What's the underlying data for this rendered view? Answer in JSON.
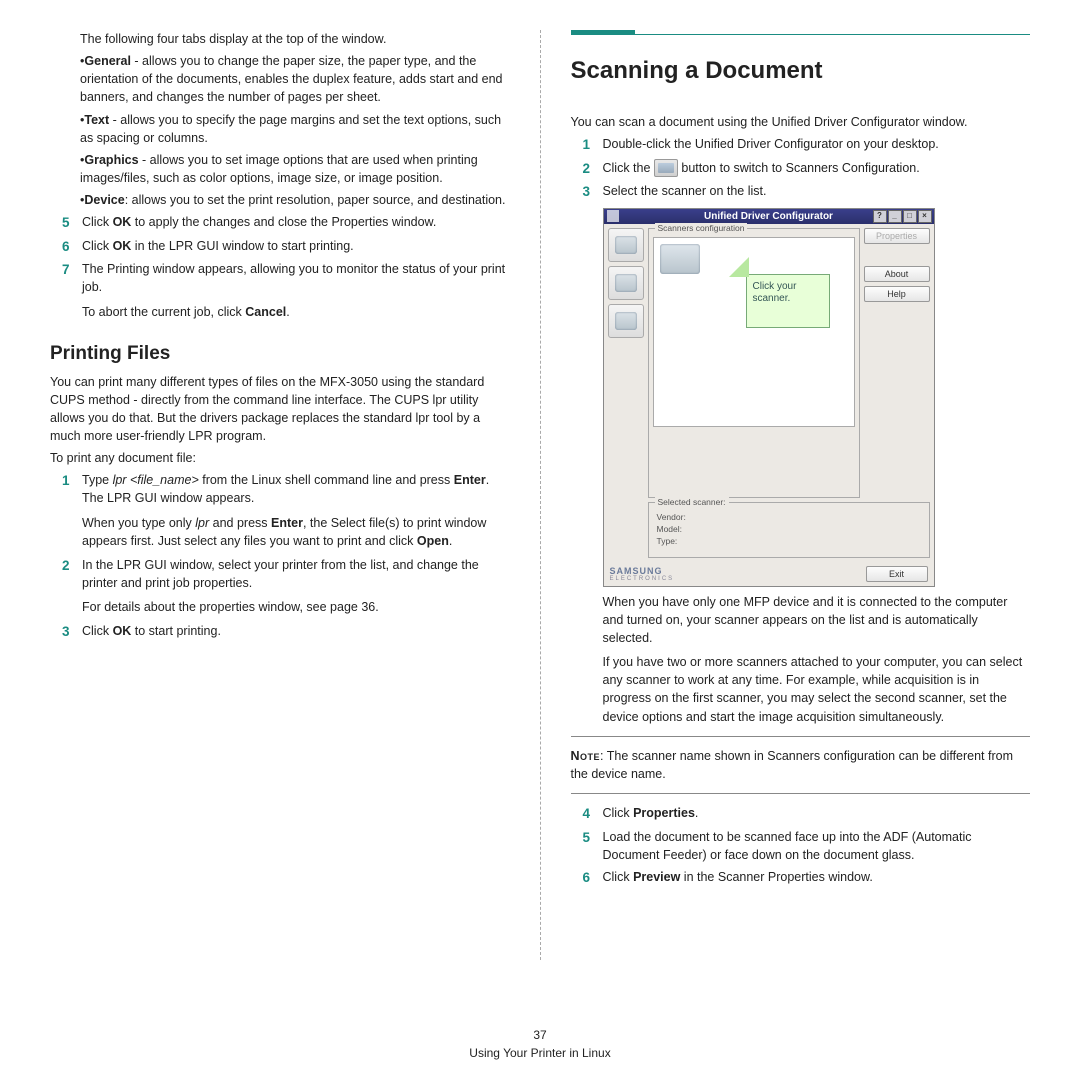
{
  "left": {
    "intro_tabs": "The following four tabs display at the top of the window.",
    "tabs": [
      {
        "name": "General",
        "desc": " - allows you to change the paper size, the paper type, and the orientation of the documents, enables the duplex feature, adds start and end banners, and changes the number of pages per sheet."
      },
      {
        "name": "Text",
        "desc": " - allows you to specify the page margins and set the text options, such as spacing or columns."
      },
      {
        "name": "Graphics",
        "desc": " - allows you to set image options that are used when printing images/files, such as color options, image size, or image position."
      },
      {
        "name": "Device",
        "desc": ": allows you to set the print resolution, paper source, and destination."
      }
    ],
    "steps_top": [
      {
        "n": "5",
        "pre": "Click ",
        "b": "OK",
        "post": " to apply the changes and close the Properties window."
      },
      {
        "n": "6",
        "pre": "Click ",
        "b": "OK",
        "post": " in the LPR GUI window to start printing."
      },
      {
        "n": "7",
        "pre": "",
        "b": "",
        "post": "The Printing window appears, allowing you to monitor the status of your print job."
      }
    ],
    "abort_pre": "To abort the current job, click ",
    "abort_b": "Cancel",
    "abort_post": ".",
    "h2": "Printing Files",
    "pf_para": "You can print many different types of files on the MFX-3050  using the standard CUPS method - directly from the command line interface. The CUPS lpr utility allows you do that. But the drivers package replaces the standard lpr tool by a much more user-friendly  LPR program.",
    "pf_lead": "To print any document file:",
    "pf_steps": [
      {
        "n": "1",
        "txt_a": "Type ",
        "it": "lpr <file_name>",
        "txt_b": " from the Linux shell command line and press ",
        "b": "Enter",
        "txt_c": ". The LPR GUI window appears.",
        "sub_a": "When you type only ",
        "sub_it": "lpr",
        "sub_b": " and press ",
        "sub_bold": "Enter",
        "sub_c": ", the Select file(s) to print window appears first. Just select any files you want to print and click ",
        "sub_bold2": "Open",
        "sub_d": "."
      },
      {
        "n": "2",
        "plain": "In the LPR GUI window, select your printer from the list, and change the printer and print job properties.",
        "sub_plain": "For details about the properties window, see page 36."
      },
      {
        "n": "3",
        "txt_a": "Click ",
        "b": "OK",
        "txt_c": " to start printing."
      }
    ]
  },
  "right": {
    "h1": "Scanning a Document",
    "intro": "You can scan a document using the Unified Driver Configurator window.",
    "steps_a": [
      {
        "n": "1",
        "plain": "Double-click the Unified Driver Configurator on your desktop."
      },
      {
        "n": "2",
        "a": "Click the ",
        "b": " button to switch to Scanners Configuration."
      },
      {
        "n": "3",
        "plain": "Select the scanner on the list."
      }
    ],
    "shot": {
      "title": "Unified Driver Configurator",
      "legend_top": "Scanners configuration",
      "legend_sel": "Selected scanner:",
      "vendor": "Vendor:",
      "model": "Model:",
      "type": "Type:",
      "btn_props": "Properties",
      "btn_about": "About",
      "btn_help": "Help",
      "btn_exit": "Exit",
      "callout": "Click your scanner.",
      "logo": "SAMSUNG",
      "sublogo": "ELECTRONICS"
    },
    "after_a": "When you have only one MFP device and it is connected to the computer and turned on, your scanner appears on the list and is automatically selected.",
    "after_b": "If you have two or more scanners attached to your computer, you can select any scanner to work at any time. For example, while acquisition is in progress on the first scanner, you may select the second scanner, set the device options and start the image acquisition simultaneously.",
    "note_label": "Note",
    "note_text": ": The scanner name shown in Scanners configuration can be different from the device name.",
    "steps_b": [
      {
        "n": "4",
        "a": "Click ",
        "b": "Properties",
        "c": "."
      },
      {
        "n": "5",
        "plain": "Load the document to be scanned face up into the ADF (Automatic Document Feeder) or face down on the document glass."
      },
      {
        "n": "6",
        "a": "Click ",
        "b": "Preview",
        "c": " in the Scanner Properties window."
      }
    ]
  },
  "footer": {
    "page": "37",
    "section": "Using Your Printer in Linux"
  }
}
